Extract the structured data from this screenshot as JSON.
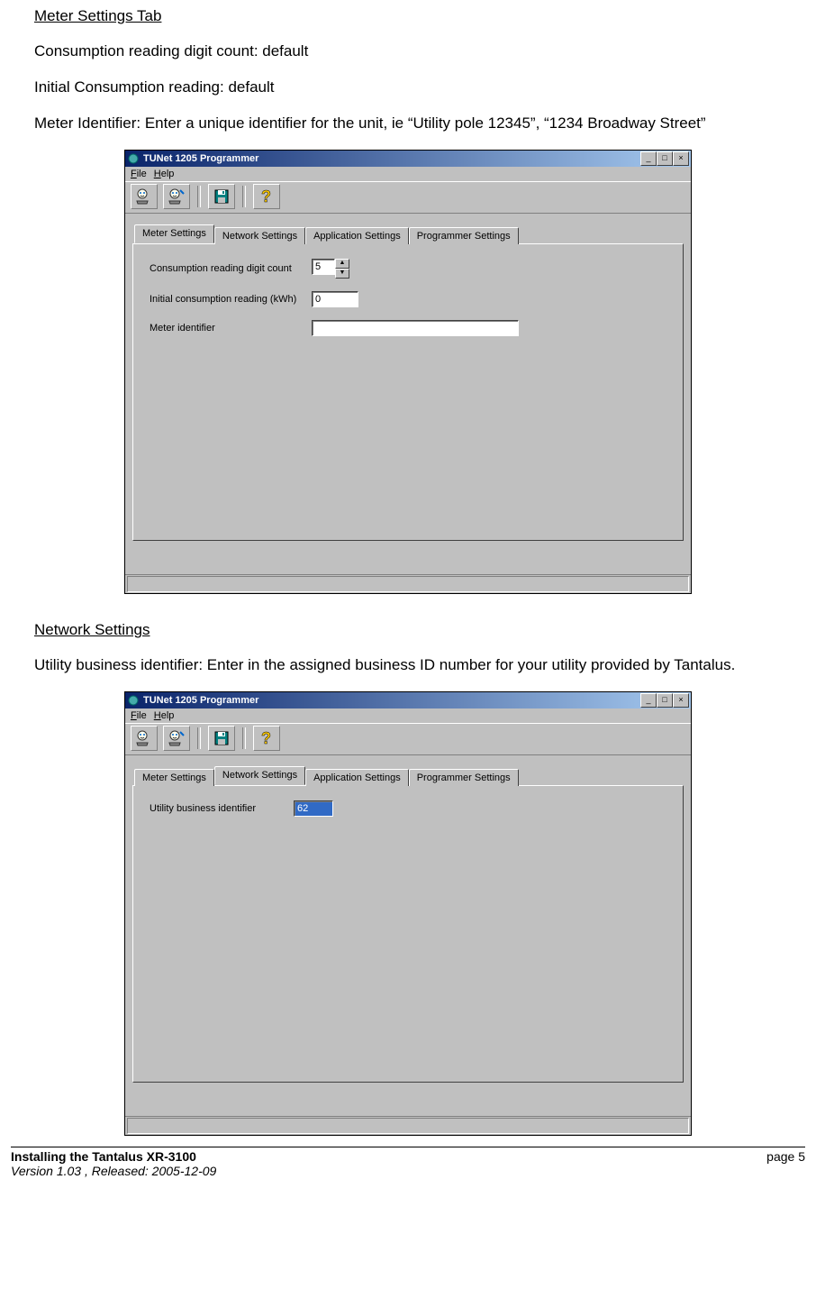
{
  "doc": {
    "heading1": "Meter Settings Tab",
    "p1": "Consumption reading digit count: default",
    "p2": "Initial Consumption reading: default",
    "p3": "Meter Identifier:  Enter a unique identifier for the unit, ie “Utility pole 12345”, “1234 Broadway Street”",
    "heading2": "Network Settings",
    "p4": "Utility business identifier: Enter in the assigned business ID number for your utility provided by Tantalus."
  },
  "app": {
    "title": "TUNet 1205 Programmer",
    "menu_file": "File",
    "menu_help": "Help",
    "tabs": [
      "Meter Settings",
      "Network Settings",
      "Application Settings",
      "Programmer Settings"
    ]
  },
  "win1": {
    "active_tab": 0,
    "fields": {
      "digit_label": "Consumption reading digit count",
      "digit_value": "5",
      "initial_label": "Initial consumption reading (kWh)",
      "initial_value": "0",
      "ident_label": "Meter identifier",
      "ident_value": ""
    }
  },
  "win2": {
    "active_tab": 1,
    "fields": {
      "biz_label": "Utility business identifier",
      "biz_value": "62"
    }
  },
  "footer": {
    "title": "Installing the Tantalus XR-3100",
    "version": "Version 1.03 , Released: 2005-12-09",
    "page": "page 5"
  }
}
